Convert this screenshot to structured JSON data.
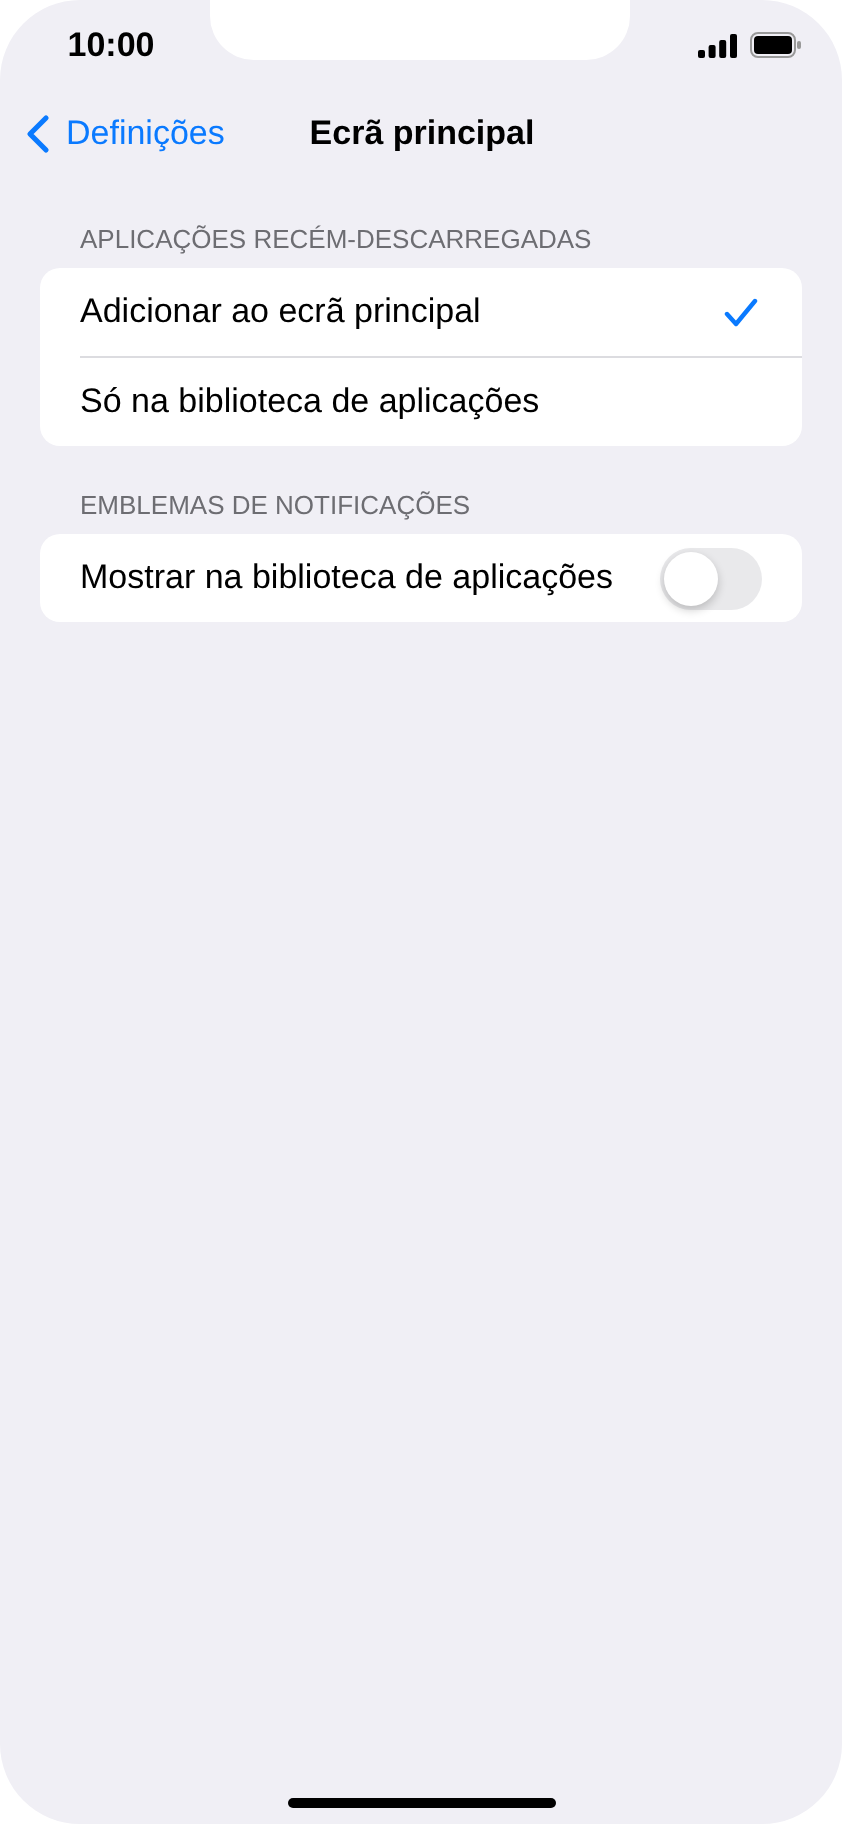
{
  "status_bar": {
    "time": "10:00"
  },
  "nav": {
    "back": "Definições",
    "title": "Ecrã principal"
  },
  "sections": [
    {
      "header": "APLICAÇÕES RECÉM-DESCARREGADAS",
      "rows": [
        {
          "kind": "choice",
          "label": "Adicionar ao ecrã principal",
          "selected": true
        },
        {
          "kind": "choice",
          "label": "Só na biblioteca de aplicações",
          "selected": false
        }
      ]
    },
    {
      "header": "EMBLEMAS DE NOTIFICAÇÕES",
      "rows": [
        {
          "kind": "toggle",
          "label": "Mostrar na biblioteca de aplicações",
          "on": false
        }
      ]
    }
  ]
}
